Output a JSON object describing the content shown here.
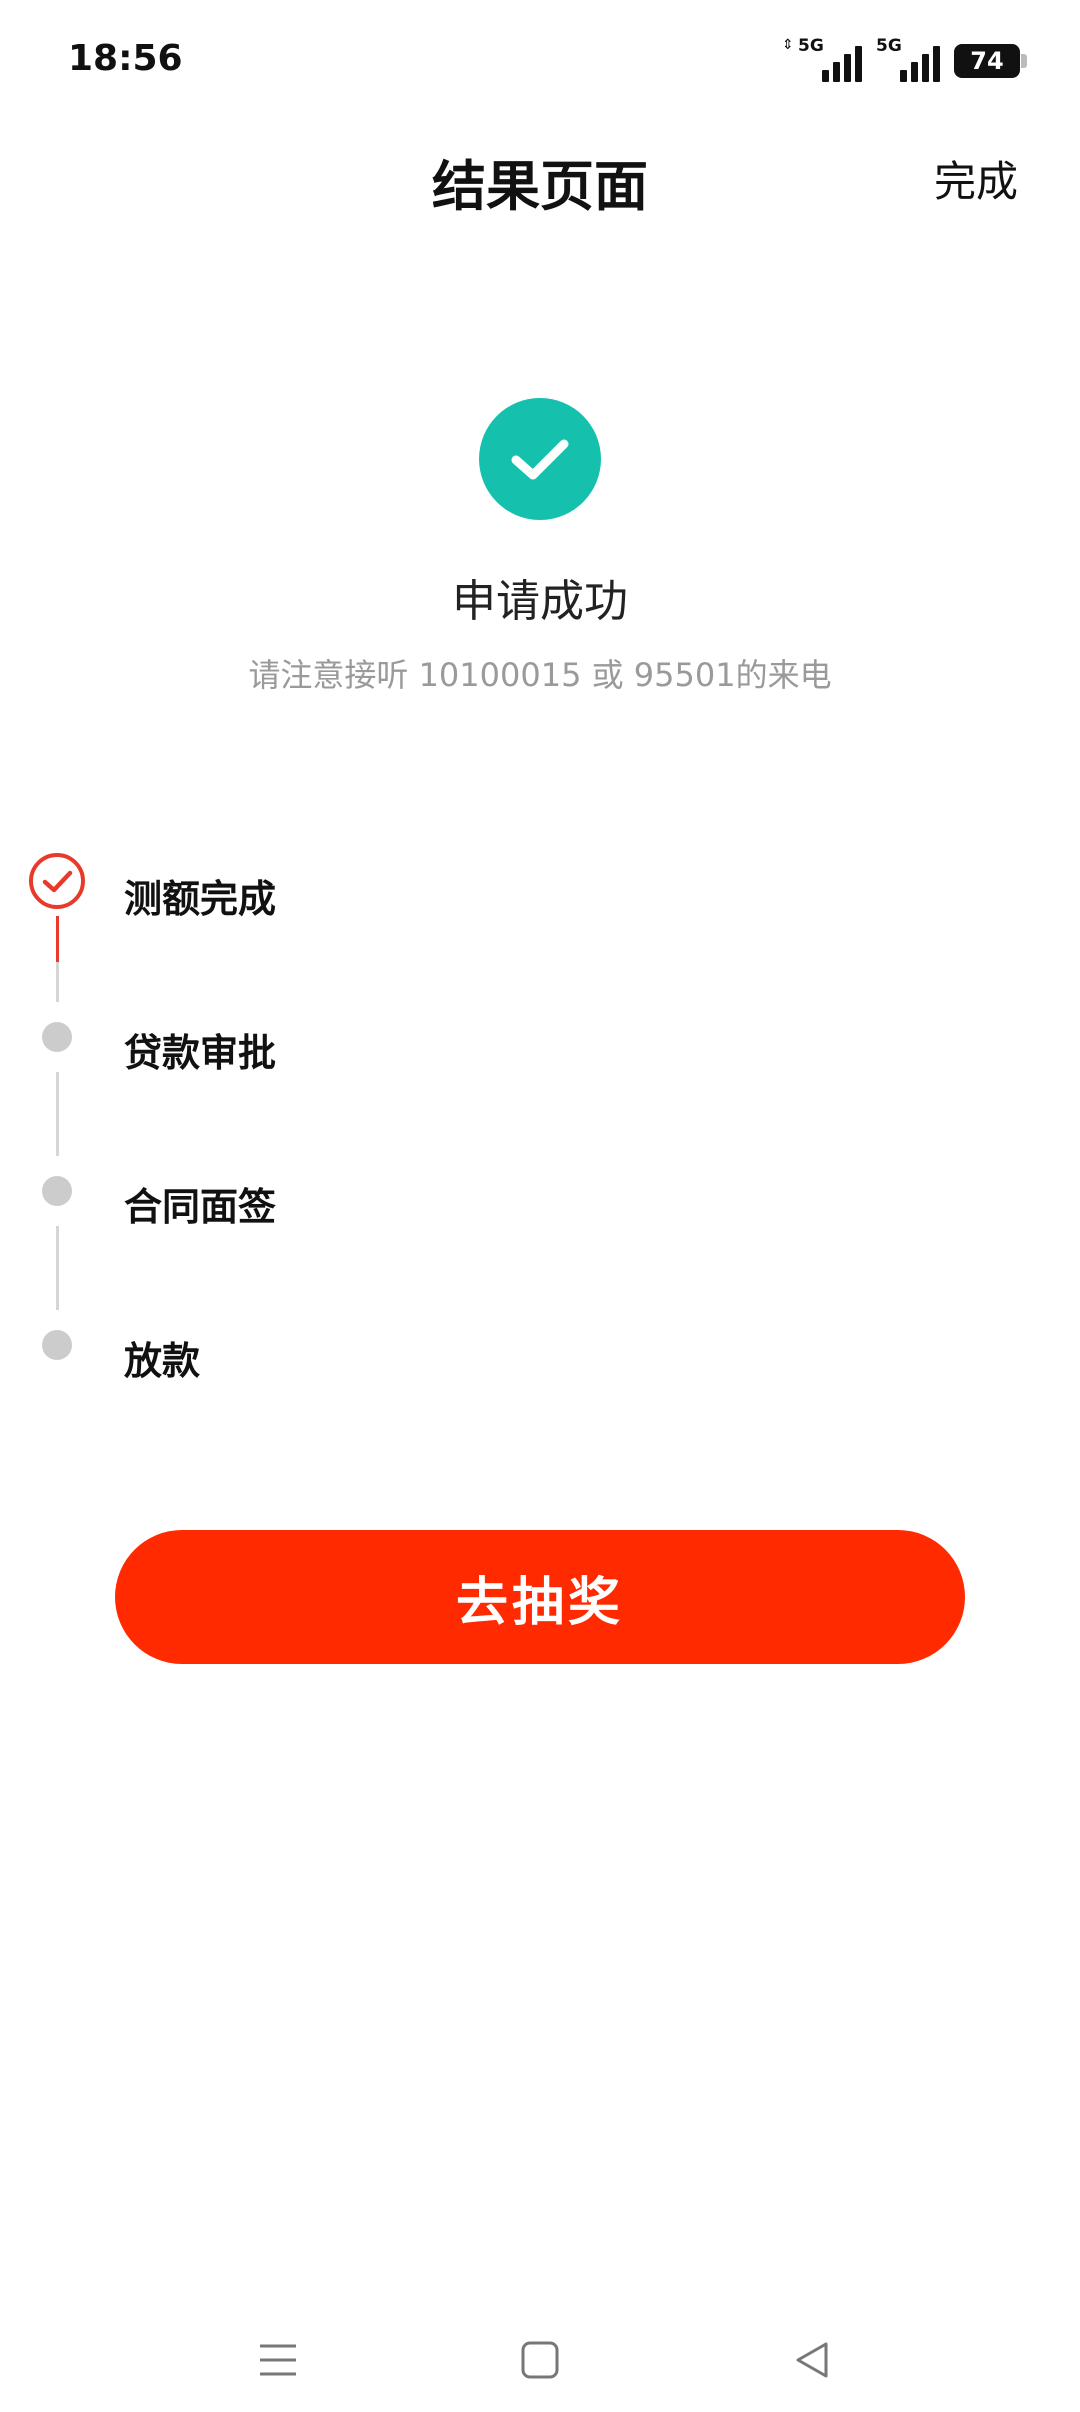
{
  "status_bar": {
    "time": "18:56",
    "network_1": "5G",
    "network_2": "5G",
    "battery": "74"
  },
  "header": {
    "title": "结果页面",
    "done_label": "完成"
  },
  "result": {
    "icon": "check-circle-icon",
    "title": "申请成功",
    "subtitle": "请注意接听 10100015 或 95501的来电"
  },
  "steps": [
    {
      "label": "测额完成",
      "state": "completed"
    },
    {
      "label": "贷款审批",
      "state": "pending"
    },
    {
      "label": "合同面签",
      "state": "pending"
    },
    {
      "label": "放款",
      "state": "pending"
    }
  ],
  "action": {
    "lottery_label": "去抽奖"
  },
  "colors": {
    "success": "#15c1ad",
    "accent": "#ff2a00",
    "step_done": "#e83a2a",
    "step_pending": "#cccccc"
  },
  "nav": {
    "icons": [
      "menu-icon",
      "home-icon",
      "back-icon"
    ]
  }
}
